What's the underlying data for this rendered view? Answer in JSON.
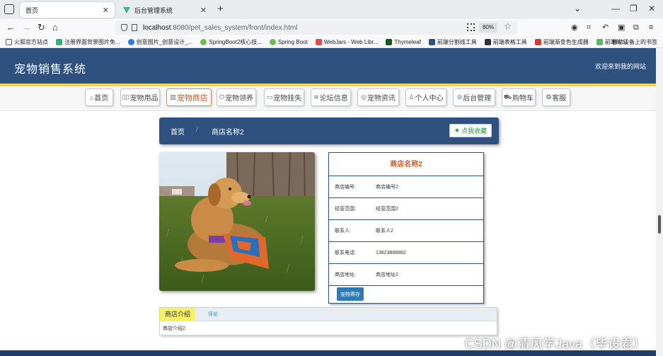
{
  "browser": {
    "tabs": [
      {
        "title": "首页",
        "active": true
      },
      {
        "title": "后台管理系统",
        "active": false
      }
    ],
    "url_host": "localhost",
    "url_path": ":8080/pet_sales_system/front/index.html",
    "zoom": "80%",
    "bookmarks": [
      "火狐官方站点",
      "注册界面背景图片免...",
      "创意图片_创意设计_...",
      "SpringBoot2核心技...",
      "Spring Boot",
      "WebJars - Web Libr...",
      "Thymeleaf",
      "前端分割线工具",
      "前端表格工具",
      "前端渐变色生成器",
      "前端练习"
    ],
    "bookmarks_right": "移动设备上的书签"
  },
  "site": {
    "title": "宠物销售系统",
    "welcome": "欢迎来到我的网站",
    "menu": [
      {
        "label": "首页",
        "icon": "home-icon",
        "glyph": "⌂"
      },
      {
        "label": "宠物用品",
        "icon": "goods-icon",
        "glyph": "▯▯"
      },
      {
        "label": "宠物商店",
        "icon": "store-icon",
        "glyph": "▥",
        "active": true
      },
      {
        "label": "宠物领养",
        "icon": "power-icon",
        "glyph": "⏻"
      },
      {
        "label": "宠物挂失",
        "icon": "card-icon",
        "glyph": "▭"
      },
      {
        "label": "论坛信息",
        "icon": "forum-icon",
        "glyph": "≋"
      },
      {
        "label": "宠物资讯",
        "icon": "news-icon",
        "glyph": "◎"
      },
      {
        "label": "个人中心",
        "icon": "user-icon",
        "glyph": "♙"
      },
      {
        "label": "后台管理",
        "icon": "link-icon",
        "glyph": "⊘"
      },
      {
        "label": "购物车",
        "icon": "cart-icon",
        "glyph": "⛟"
      },
      {
        "label": "客服",
        "icon": "service-icon",
        "glyph": "❂"
      }
    ]
  },
  "breadcrumb": {
    "home": "首页",
    "separator": "/",
    "current": "商店名称2"
  },
  "favorite_button": "点我收藏",
  "store": {
    "name": "商店名称2",
    "rows": [
      {
        "label": "商店编号:",
        "value": "商店编号2"
      },
      {
        "label": "经营范围:",
        "value": "经营范围2"
      },
      {
        "label": "联系人:",
        "value": "联系人2"
      },
      {
        "label": "联系电话:",
        "value": "13823888882"
      },
      {
        "label": "商店地址:",
        "value": "商店地址2"
      }
    ],
    "stock_button": "宠物寄存"
  },
  "detail": {
    "tabs": [
      "商店介绍",
      "评论"
    ],
    "content": "商店介绍2"
  },
  "watermark": "CSDN @清风学Java（毕设君）",
  "colors": {
    "header": "#2e5180",
    "accent_yellow": "#f5d547",
    "active_menu": "#c75a2a"
  }
}
